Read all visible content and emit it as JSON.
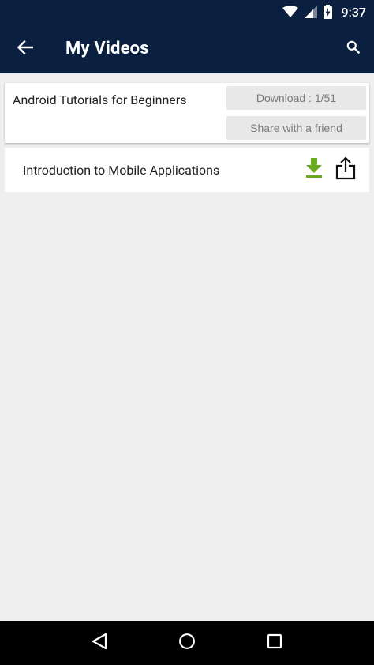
{
  "status_bar": {
    "time": "9:37"
  },
  "app_bar": {
    "title": "My Videos"
  },
  "playlist": {
    "title": "Android Tutorials for Beginners",
    "download_label": "Download : 1/51",
    "share_label": "Share with a friend"
  },
  "videos": [
    {
      "title": "Introduction to Mobile Applications"
    }
  ],
  "colors": {
    "app_bar": "#0b1f40",
    "download_icon": "#6aaa1e",
    "background": "#eeeeee"
  },
  "icons": {
    "back": "arrow-left-icon",
    "search": "search-icon",
    "download": "download-icon",
    "share": "share-icon"
  }
}
